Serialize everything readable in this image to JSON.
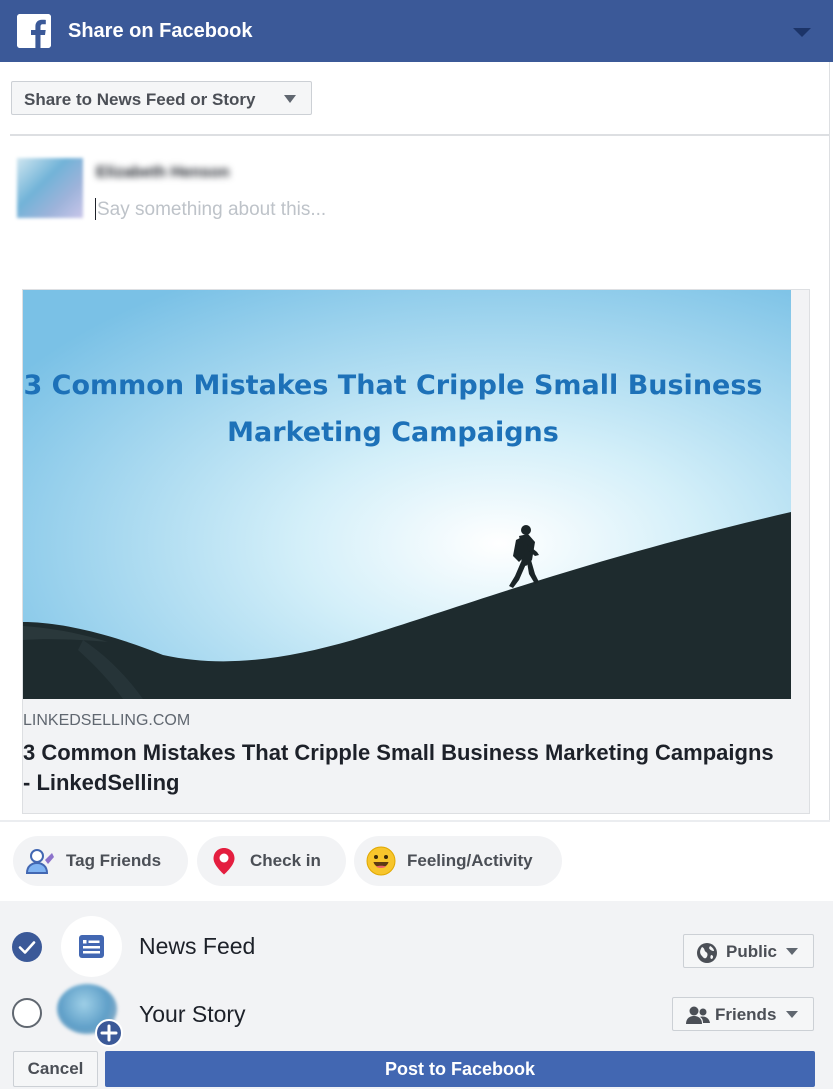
{
  "header": {
    "title": "Share on Facebook",
    "icon": "facebook-logo-icon",
    "menu_icon": "chevron-down-icon",
    "color": "#3b5998"
  },
  "share_target": {
    "label": "Share to News Feed or Story"
  },
  "composer": {
    "user_name": "Elizabeth Henson",
    "placeholder": "Say something about this...",
    "value": ""
  },
  "link_preview": {
    "image_text": "3 Common Mistakes That Cripple Small Business Marketing Campaigns",
    "domain": "LINKEDSELLING.COM",
    "title": "3 Common Mistakes That Cripple Small Business Marketing Campaigns - LinkedSelling"
  },
  "actions": {
    "tag_friends": {
      "label": "Tag Friends",
      "icon": "tag-friends-icon"
    },
    "check_in": {
      "label": "Check in",
      "icon": "location-pin-icon"
    },
    "feeling": {
      "label": "Feeling/Activity",
      "icon": "smiley-icon"
    }
  },
  "destinations": {
    "news_feed": {
      "label": "News Feed",
      "checked": true,
      "privacy": "Public",
      "privacy_icon": "globe-icon"
    },
    "your_story": {
      "label": "Your Story",
      "checked": false,
      "privacy": "Friends",
      "privacy_icon": "friends-icon"
    }
  },
  "buttons": {
    "cancel": "Cancel",
    "post": "Post to Facebook"
  },
  "colors": {
    "primary": "#4267b2",
    "header": "#3b5998",
    "pin": "#e41e3f",
    "image_title": "#1d71b8"
  }
}
